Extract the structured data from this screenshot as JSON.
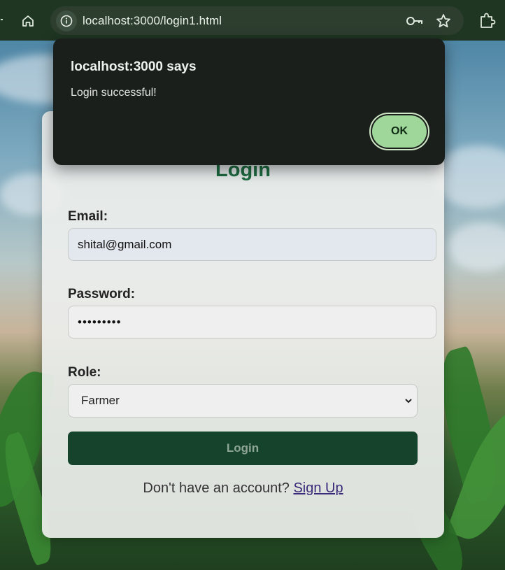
{
  "browser": {
    "url": "localhost:3000/login1.html"
  },
  "dialog": {
    "title": "localhost:3000 says",
    "message": "Login successful!",
    "ok_label": "OK"
  },
  "login_form": {
    "title": "Login",
    "email_label": "Email:",
    "email_value": "shital@gmail.com",
    "password_label": "Password:",
    "password_value": "•••••••••",
    "role_label": "Role:",
    "role_value": "Farmer",
    "submit_label": "Login",
    "signup_prompt": "Don't have an account?",
    "signup_link": "Sign Up"
  },
  "colors": {
    "accent": "#1e6b42",
    "button_bg": "#16432c",
    "dialog_ok": "#9fd79a"
  }
}
